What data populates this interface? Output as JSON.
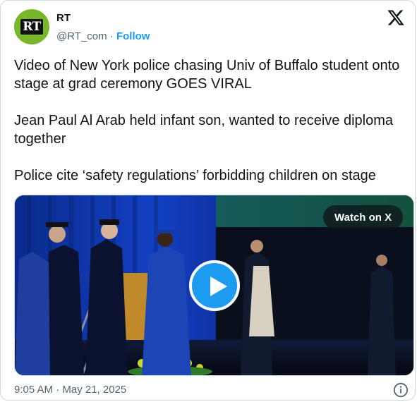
{
  "author": {
    "avatar_text": "RT",
    "avatar_bg": "#76b82a",
    "name": "RT",
    "handle": "@RT_com",
    "separator": " · ",
    "follow_label": "Follow"
  },
  "tweet": {
    "paragraphs": [
      "Video of New York police chasing Univ of Buffalo student onto stage at grad ceremony GOES VIRAL",
      "Jean Paul Al Arab held infant son, wanted to receive diploma together",
      "Police cite ‘safety regulations’ forbidding children on stage"
    ]
  },
  "media": {
    "watch_label": "Watch on X",
    "play_icon": "play-icon",
    "accent": "#1d9bf0"
  },
  "footer": {
    "timestamp": "9:05 AM · May 21, 2025",
    "info_icon": "info-icon"
  },
  "icons": {
    "brand": "x-logo-icon"
  }
}
